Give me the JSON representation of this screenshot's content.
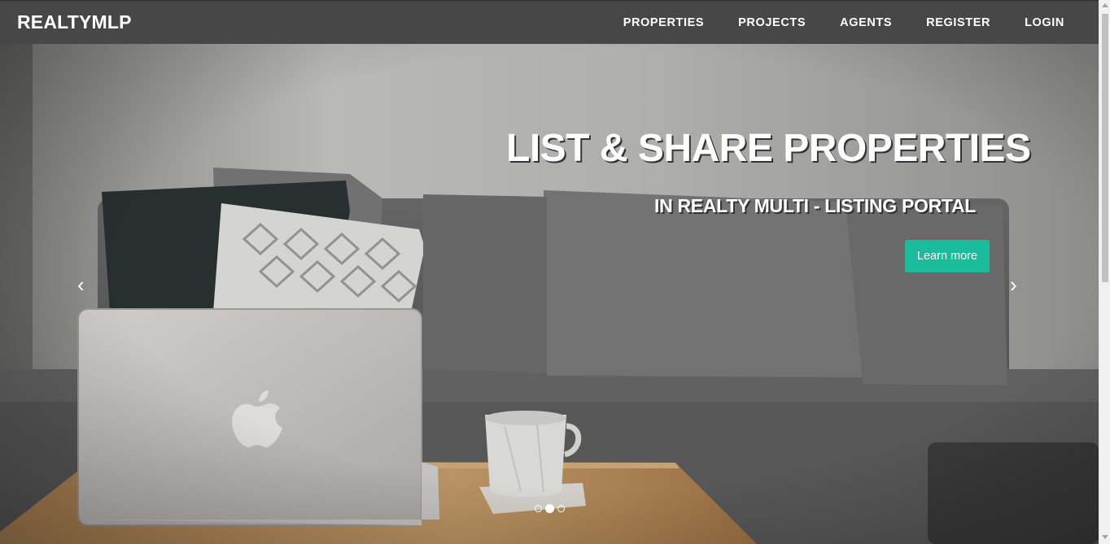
{
  "navbar": {
    "brand": "REALTYMLP",
    "items": [
      {
        "label": "PROPERTIES"
      },
      {
        "label": "PROJECTS"
      },
      {
        "label": "AGENTS"
      },
      {
        "label": "REGISTER"
      },
      {
        "label": "LOGIN"
      }
    ]
  },
  "hero": {
    "headline": "LIST & SHARE PROPERTIES",
    "subheadline": "IN REALTY MULTI - LISTING PORTAL",
    "cta_label": "Learn more",
    "prev_arrow": "‹",
    "next_arrow": "›",
    "slide_count": 3,
    "active_slide": 2
  },
  "colors": {
    "navbar": "#474747",
    "accent": "#1abc9c",
    "text": "#ffffff"
  },
  "icons": {
    "prev": "chevron-left-icon",
    "next": "chevron-right-icon",
    "laptop_logo": "apple-logo-icon"
  }
}
